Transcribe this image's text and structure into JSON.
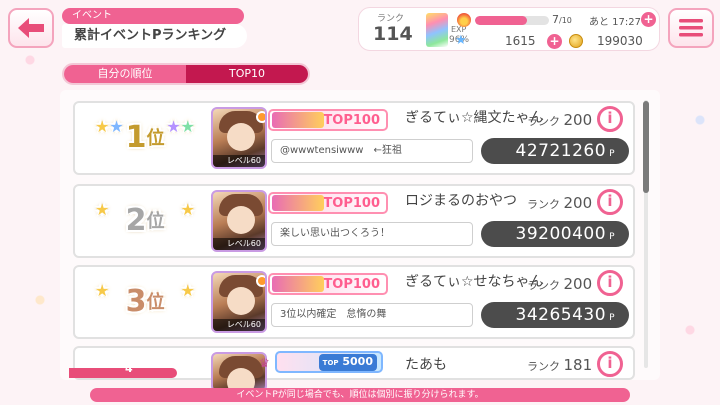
{
  "header": {
    "event_tag": "イベント",
    "title": "累計イベントPランキング"
  },
  "status": {
    "rank_label": "ランク",
    "rank_value": "114",
    "exp_label": "EXP",
    "exp_percent": "96%",
    "fire_current": "7",
    "fire_max": "/10",
    "fire_fill_fraction": 0.7,
    "recover_text": "あと 17:27",
    "stars": "1615",
    "coins": "199030"
  },
  "tabs": [
    {
      "label": "自分の順位",
      "active": true
    },
    {
      "label": "TOP10",
      "active": false
    }
  ],
  "rows": [
    {
      "rank": "1",
      "rank_suffix": "位",
      "level": "レベル60",
      "badge": "TOP100",
      "name": "ぎるてぃ☆縄文たゃん",
      "rank_label": "ランク",
      "player_rank": "200",
      "comment": "@wwwtensiwww　←狂祖",
      "points": "42721260",
      "points_unit": "P"
    },
    {
      "rank": "2",
      "rank_suffix": "位",
      "level": "レベル60",
      "badge": "TOP100",
      "name": "ロジまるのおやつ",
      "rank_label": "ランク",
      "player_rank": "200",
      "comment": "楽しい思い出つくろう！",
      "points": "39200400",
      "points_unit": "P"
    },
    {
      "rank": "3",
      "rank_suffix": "位",
      "level": "レベル60",
      "badge": "TOP100",
      "name": "ぎるてぃ☆せなちゃん",
      "rank_label": "ランク",
      "player_rank": "200",
      "comment": "3位以内確定　怠惰の舞",
      "points": "34265430",
      "points_unit": "P"
    },
    {
      "rank": "4",
      "badge": "5000",
      "badge_top_label": "TOP",
      "name": "たあも",
      "rank_label": "ランク",
      "player_rank": "181"
    }
  ],
  "footer": {
    "notice": "イベントPが同じ場合でも、順位は個別に振り分けられます。"
  },
  "colors": {
    "accent": "#f06292",
    "accent_dark": "#c3184f",
    "points_bg": "#4c4c4c"
  }
}
